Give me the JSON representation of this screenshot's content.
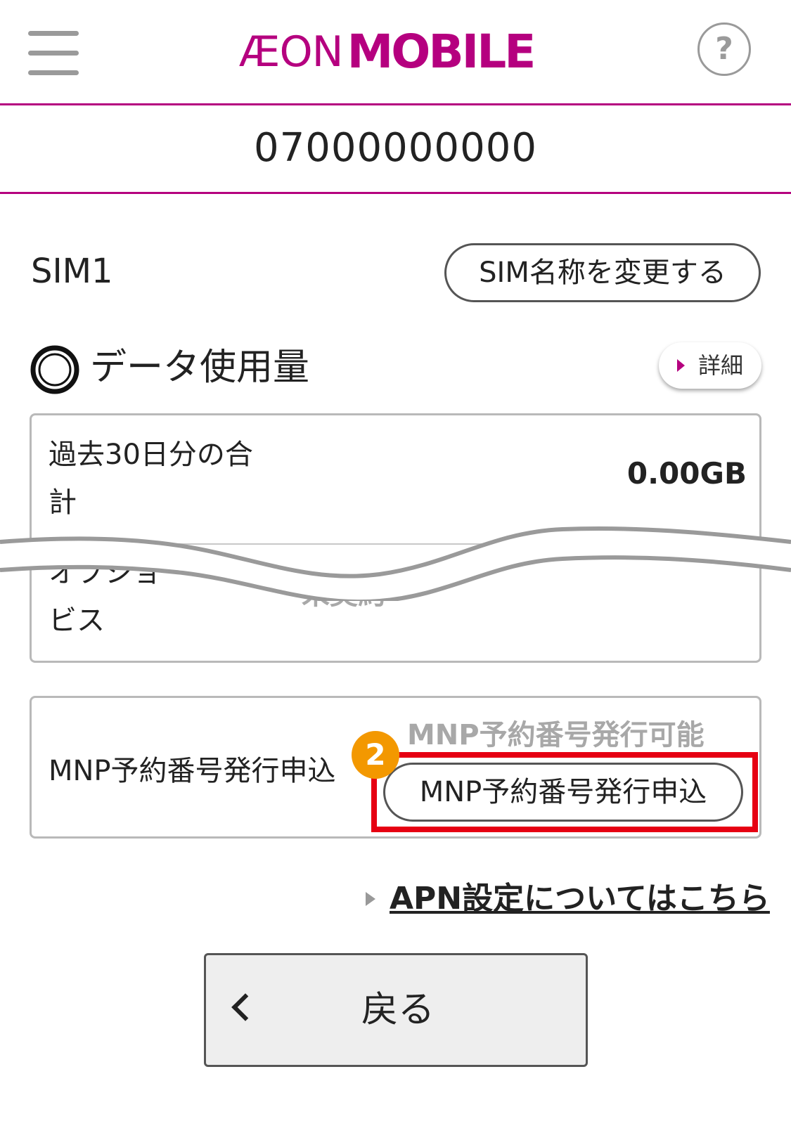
{
  "header": {
    "menu_icon": "hamburger-menu-icon",
    "logo": {
      "part1": "ÆON",
      "part2": "MOBILE"
    },
    "help_icon": "question-circle-icon",
    "help_glyph": "?",
    "brand_color": "#b5007f"
  },
  "phone_number": "07000000000",
  "sim": {
    "name": "SIM1",
    "rename_button": "SIM名称を変更する"
  },
  "data_usage": {
    "icon": "data-ring-icon",
    "title": "データ使用量",
    "detail_button": "詳細",
    "total_label_line1": "過去30日分の合",
    "total_label_line2": "計",
    "total_value": "0.00GB",
    "option_label_line1": "オプショ",
    "option_label_line2": "ビス",
    "option_value": "未契約"
  },
  "mnp": {
    "label": "MNP予約番号発行申込",
    "status": "MNP予約番号発行可能",
    "button": "MNP予約番号発行申込",
    "step_badge": "2",
    "highlight_color": "#e60012",
    "badge_color": "#f39800"
  },
  "apn_link": "APN設定についてはこちら",
  "back_button": "戻る"
}
